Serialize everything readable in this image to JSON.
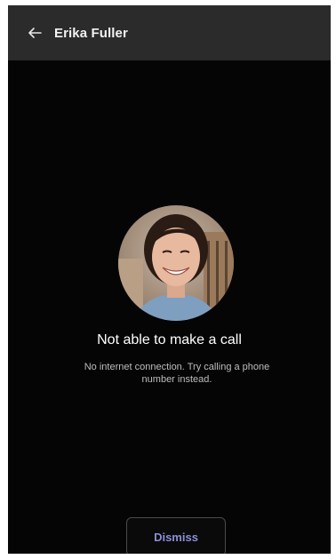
{
  "header": {
    "back_icon": "arrow-left-icon",
    "contact_name": "Erika Fuller"
  },
  "call_error": {
    "title": "Not able to make a call",
    "message": "No internet connection. Try calling a phone number instead.",
    "avatar": "contact-photo"
  },
  "actions": {
    "dismiss_label": "Dismiss"
  },
  "colors": {
    "background": "#050505",
    "app_bar": "#2b2b2b",
    "accent": "#8b8fd6"
  }
}
